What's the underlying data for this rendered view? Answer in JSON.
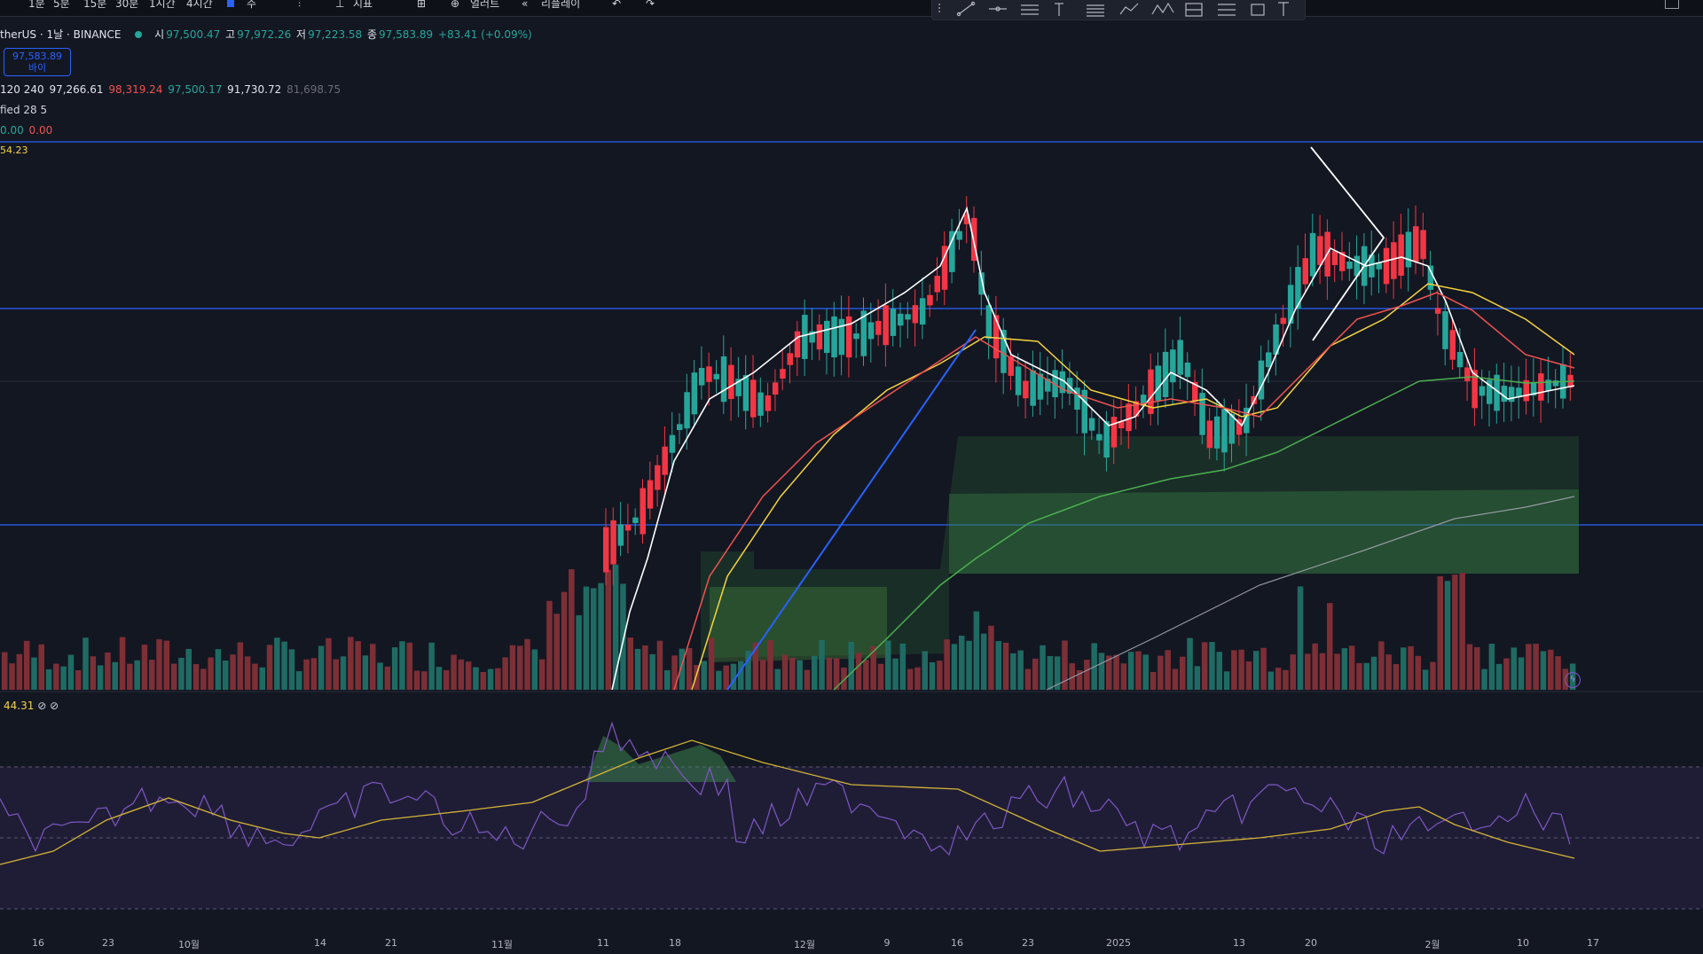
{
  "toolbar": {
    "intervals": [
      "1분",
      "5분",
      "15분",
      "30분",
      "1시간",
      "4시간"
    ],
    "active_interval": "주",
    "indicators_label": "지표",
    "alert_label": "얼러트",
    "replay_label": "리플레이"
  },
  "legend": {
    "symbol": "therUS · 1날 · BINANCE",
    "o_label": "시",
    "o": "97,500.47",
    "h_label": "고",
    "h": "97,972.26",
    "l_label": "저",
    "l": "97,223.58",
    "c_label": "종",
    "c": "97,583.89",
    "change": "+83.41 (+0.09%)",
    "ma_prefix": "120 240",
    "ma_values": [
      "97,266.61",
      "98,319.24",
      "97,500.17",
      "91,730.72",
      "81,698.75"
    ],
    "indicator2": "fied 28 5",
    "ind3_a": "0.00",
    "ind3_b": "0.00",
    "hline_price": "54.23"
  },
  "price_box": {
    "price": "97,583.89",
    "action": "바이"
  },
  "rsi": {
    "value": "44.31",
    "icons": [
      "eye-off-icon",
      "eye-off-icon"
    ]
  },
  "x_axis": {
    "labels": [
      "16",
      "23",
      "10월",
      "14",
      "21",
      "11월",
      "11",
      "18",
      "12월",
      "9",
      "16",
      "23",
      "2025",
      "13",
      "20",
      "2월",
      "10",
      "17"
    ]
  },
  "colors": {
    "background": "#131722",
    "up": "#26a69a",
    "down": "#f23645",
    "hline": "#2962ff",
    "ma_white": "#ffffff",
    "ma_yellow": "#f5d33f",
    "ma_red": "#ef5350",
    "ma_green": "#4caf50",
    "rsi_line": "#7e57c2",
    "rsi_ma": "#d4b537"
  }
}
